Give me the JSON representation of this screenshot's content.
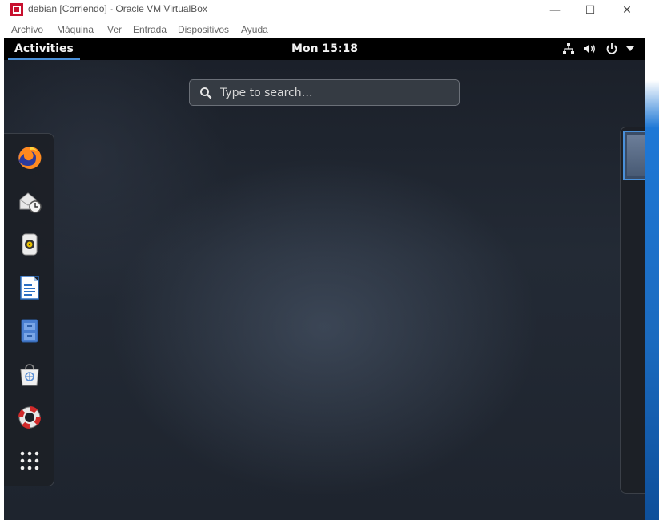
{
  "window": {
    "title": "debian [Corriendo] - Oracle VM VirtualBox",
    "controls": {
      "minimize": "—",
      "maximize": "☐",
      "close": "✕"
    }
  },
  "menubar": {
    "items": [
      "Archivo",
      "Máquina",
      "Ver",
      "Entrada",
      "Dispositivos",
      "Ayuda"
    ]
  },
  "gnome": {
    "activities_label": "Activities",
    "clock": "Mon 15:18",
    "search_placeholder": "Type to search…",
    "dash_icons": [
      "firefox-icon",
      "evolution-icon",
      "rhythmbox-icon",
      "libreoffice-writer-icon",
      "files-icon",
      "software-icon",
      "help-icon",
      "show-applications-icon"
    ],
    "tray_icons": [
      "network-icon",
      "volume-icon",
      "power-icon",
      "chevron-down-icon"
    ]
  },
  "colors": {
    "accent": "#4a90d9",
    "topbar": "#000000",
    "host_accent": "#1c73c9"
  }
}
